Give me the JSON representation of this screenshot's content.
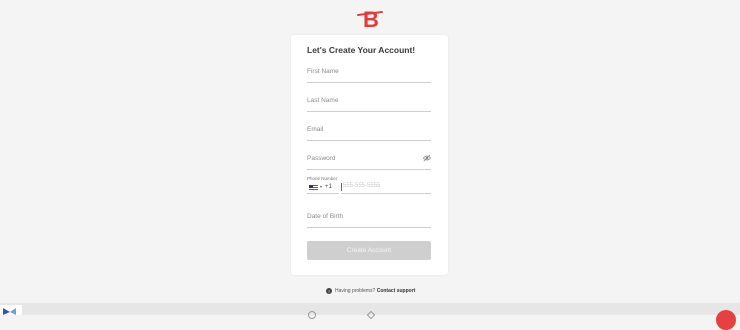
{
  "brand": {
    "logo_letter": "B",
    "accent": "#e23b3b"
  },
  "form": {
    "title": "Let's Create Your Account!",
    "first_name_placeholder": "First Name",
    "last_name_placeholder": "Last Name",
    "email_placeholder": "Email",
    "password_placeholder": "Password",
    "phone_label": "Phone Number",
    "country_code": "+1",
    "phone_placeholder": "555-555-5555",
    "dob_placeholder": "Date of Birth",
    "submit_label": "Create Account",
    "submit_color": "#cfcfcf"
  },
  "help": {
    "question_icon": "question-icon",
    "text": "Having problems?",
    "link": "Contact support"
  }
}
